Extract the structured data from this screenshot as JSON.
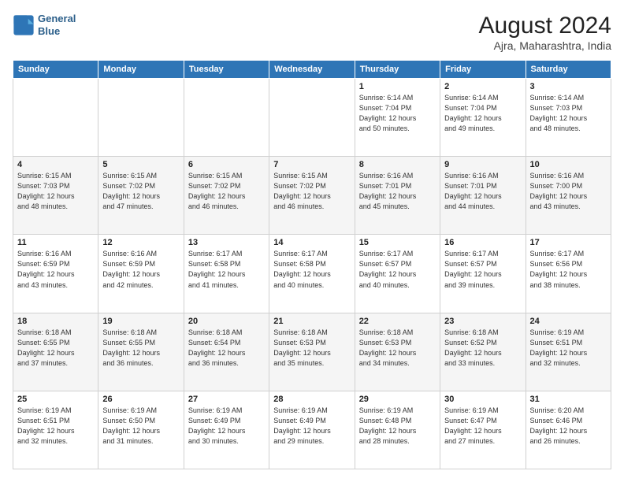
{
  "header": {
    "logo_line1": "General",
    "logo_line2": "Blue",
    "month_year": "August 2024",
    "location": "Ajra, Maharashtra, India"
  },
  "weekdays": [
    "Sunday",
    "Monday",
    "Tuesday",
    "Wednesday",
    "Thursday",
    "Friday",
    "Saturday"
  ],
  "weeks": [
    [
      {
        "day": "",
        "info": ""
      },
      {
        "day": "",
        "info": ""
      },
      {
        "day": "",
        "info": ""
      },
      {
        "day": "",
        "info": ""
      },
      {
        "day": "1",
        "info": "Sunrise: 6:14 AM\nSunset: 7:04 PM\nDaylight: 12 hours\nand 50 minutes."
      },
      {
        "day": "2",
        "info": "Sunrise: 6:14 AM\nSunset: 7:04 PM\nDaylight: 12 hours\nand 49 minutes."
      },
      {
        "day": "3",
        "info": "Sunrise: 6:14 AM\nSunset: 7:03 PM\nDaylight: 12 hours\nand 48 minutes."
      }
    ],
    [
      {
        "day": "4",
        "info": "Sunrise: 6:15 AM\nSunset: 7:03 PM\nDaylight: 12 hours\nand 48 minutes."
      },
      {
        "day": "5",
        "info": "Sunrise: 6:15 AM\nSunset: 7:02 PM\nDaylight: 12 hours\nand 47 minutes."
      },
      {
        "day": "6",
        "info": "Sunrise: 6:15 AM\nSunset: 7:02 PM\nDaylight: 12 hours\nand 46 minutes."
      },
      {
        "day": "7",
        "info": "Sunrise: 6:15 AM\nSunset: 7:02 PM\nDaylight: 12 hours\nand 46 minutes."
      },
      {
        "day": "8",
        "info": "Sunrise: 6:16 AM\nSunset: 7:01 PM\nDaylight: 12 hours\nand 45 minutes."
      },
      {
        "day": "9",
        "info": "Sunrise: 6:16 AM\nSunset: 7:01 PM\nDaylight: 12 hours\nand 44 minutes."
      },
      {
        "day": "10",
        "info": "Sunrise: 6:16 AM\nSunset: 7:00 PM\nDaylight: 12 hours\nand 43 minutes."
      }
    ],
    [
      {
        "day": "11",
        "info": "Sunrise: 6:16 AM\nSunset: 6:59 PM\nDaylight: 12 hours\nand 43 minutes."
      },
      {
        "day": "12",
        "info": "Sunrise: 6:16 AM\nSunset: 6:59 PM\nDaylight: 12 hours\nand 42 minutes."
      },
      {
        "day": "13",
        "info": "Sunrise: 6:17 AM\nSunset: 6:58 PM\nDaylight: 12 hours\nand 41 minutes."
      },
      {
        "day": "14",
        "info": "Sunrise: 6:17 AM\nSunset: 6:58 PM\nDaylight: 12 hours\nand 40 minutes."
      },
      {
        "day": "15",
        "info": "Sunrise: 6:17 AM\nSunset: 6:57 PM\nDaylight: 12 hours\nand 40 minutes."
      },
      {
        "day": "16",
        "info": "Sunrise: 6:17 AM\nSunset: 6:57 PM\nDaylight: 12 hours\nand 39 minutes."
      },
      {
        "day": "17",
        "info": "Sunrise: 6:17 AM\nSunset: 6:56 PM\nDaylight: 12 hours\nand 38 minutes."
      }
    ],
    [
      {
        "day": "18",
        "info": "Sunrise: 6:18 AM\nSunset: 6:55 PM\nDaylight: 12 hours\nand 37 minutes."
      },
      {
        "day": "19",
        "info": "Sunrise: 6:18 AM\nSunset: 6:55 PM\nDaylight: 12 hours\nand 36 minutes."
      },
      {
        "day": "20",
        "info": "Sunrise: 6:18 AM\nSunset: 6:54 PM\nDaylight: 12 hours\nand 36 minutes."
      },
      {
        "day": "21",
        "info": "Sunrise: 6:18 AM\nSunset: 6:53 PM\nDaylight: 12 hours\nand 35 minutes."
      },
      {
        "day": "22",
        "info": "Sunrise: 6:18 AM\nSunset: 6:53 PM\nDaylight: 12 hours\nand 34 minutes."
      },
      {
        "day": "23",
        "info": "Sunrise: 6:18 AM\nSunset: 6:52 PM\nDaylight: 12 hours\nand 33 minutes."
      },
      {
        "day": "24",
        "info": "Sunrise: 6:19 AM\nSunset: 6:51 PM\nDaylight: 12 hours\nand 32 minutes."
      }
    ],
    [
      {
        "day": "25",
        "info": "Sunrise: 6:19 AM\nSunset: 6:51 PM\nDaylight: 12 hours\nand 32 minutes."
      },
      {
        "day": "26",
        "info": "Sunrise: 6:19 AM\nSunset: 6:50 PM\nDaylight: 12 hours\nand 31 minutes."
      },
      {
        "day": "27",
        "info": "Sunrise: 6:19 AM\nSunset: 6:49 PM\nDaylight: 12 hours\nand 30 minutes."
      },
      {
        "day": "28",
        "info": "Sunrise: 6:19 AM\nSunset: 6:49 PM\nDaylight: 12 hours\nand 29 minutes."
      },
      {
        "day": "29",
        "info": "Sunrise: 6:19 AM\nSunset: 6:48 PM\nDaylight: 12 hours\nand 28 minutes."
      },
      {
        "day": "30",
        "info": "Sunrise: 6:19 AM\nSunset: 6:47 PM\nDaylight: 12 hours\nand 27 minutes."
      },
      {
        "day": "31",
        "info": "Sunrise: 6:20 AM\nSunset: 6:46 PM\nDaylight: 12 hours\nand 26 minutes."
      }
    ]
  ]
}
